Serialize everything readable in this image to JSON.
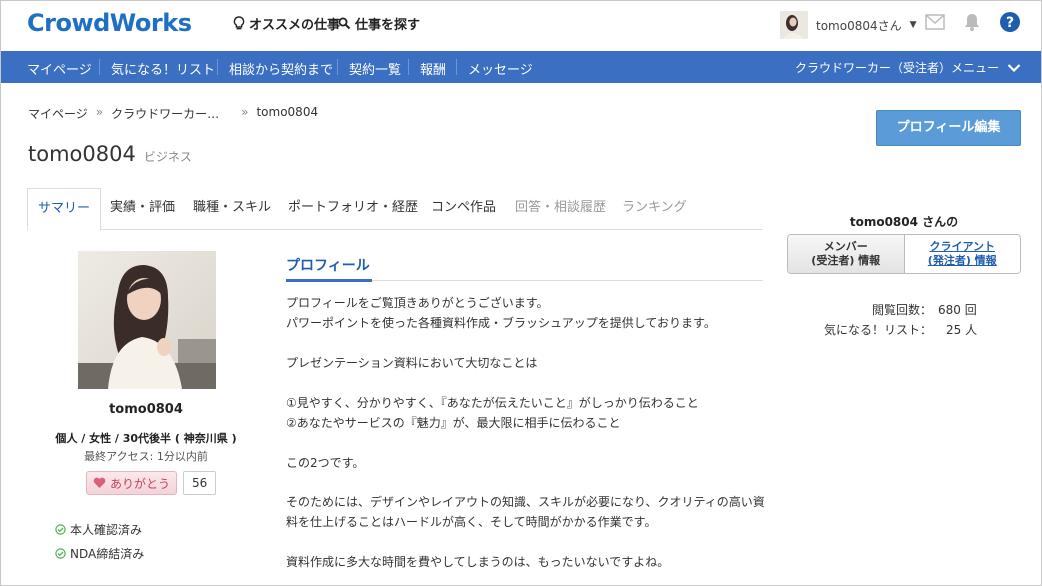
{
  "header": {
    "logo": "CrowdWorks",
    "recommended": "オススメの仕事",
    "search_jobs": "仕事を探す",
    "username": "tomo0804さん"
  },
  "nav": {
    "items": [
      "マイページ",
      "気になる！リスト",
      "相談から契約まで",
      "契約一覧",
      "報酬",
      "メッセージ"
    ],
    "right_menu": "クラウドワーカー（受注者）メニュー"
  },
  "breadcrumb": [
    "マイページ",
    "クラウドワーカー…",
    "tomo0804"
  ],
  "breadcrumb_sep": "»",
  "profile": {
    "name": "tomo0804",
    "category": "ビジネス",
    "edit_label": "プロフィール編集",
    "attributes": "個人 / 女性 / 30代後半 ( 神奈川県 )",
    "last_access": "最終アクセス: 1分以内前",
    "thanks_label": "ありがとう",
    "thanks_count": "56",
    "verifications": [
      "本人確認済み",
      "NDA締結済み"
    ]
  },
  "tabs": [
    {
      "label": "サマリー",
      "state": "active"
    },
    {
      "label": "実績・評価",
      "state": "normal"
    },
    {
      "label": "職種・スキル",
      "state": "normal"
    },
    {
      "label": "ポートフォリオ・経歴",
      "state": "normal"
    },
    {
      "label": "コンペ作品",
      "state": "normal"
    },
    {
      "label": "回答・相談履歴",
      "state": "muted"
    },
    {
      "label": "ランキング",
      "state": "muted"
    }
  ],
  "section": {
    "title": "プロフィール",
    "lines": [
      "プロフィールをご覧頂きありがとうございます。",
      "パワーポイントを使った各種資料作成・ブラッシュアップを提供しております。",
      "",
      "プレゼンテーション資料において大切なことは",
      "",
      "①見やすく、分かりやすく、『あなたが伝えたいこと』がしっかり伝わること",
      "②あなたやサービスの『魅力』が、最大限に相手に伝わること",
      "",
      "この2つです。",
      "",
      "そのためには、デザインやレイアウトの知識、スキルが必要になり、クオリティの高い資",
      "料を仕上げることはハードルが高く、そして時間がかかる作業です。",
      "",
      "資料作成に多大な時間を費やしてしまうのは、もったいないですよね。"
    ]
  },
  "side": {
    "title": "tomo0804 さんの",
    "member_line1": "メンバー",
    "member_line2": "(受注者) 情報",
    "client_line1": "クライアント",
    "client_line2": "(発注者) 情報",
    "views_label": "閲覧回数：",
    "views_value": "680 回",
    "fav_label": "気になる！リスト：",
    "fav_value": "25 人"
  },
  "colors": {
    "brand": "#1f6fc5",
    "nav_bg": "#3a6fc1",
    "edit_button": "#5b9bd8",
    "thanks_pink": "#c2455f",
    "verify_green": "#4caf50"
  }
}
